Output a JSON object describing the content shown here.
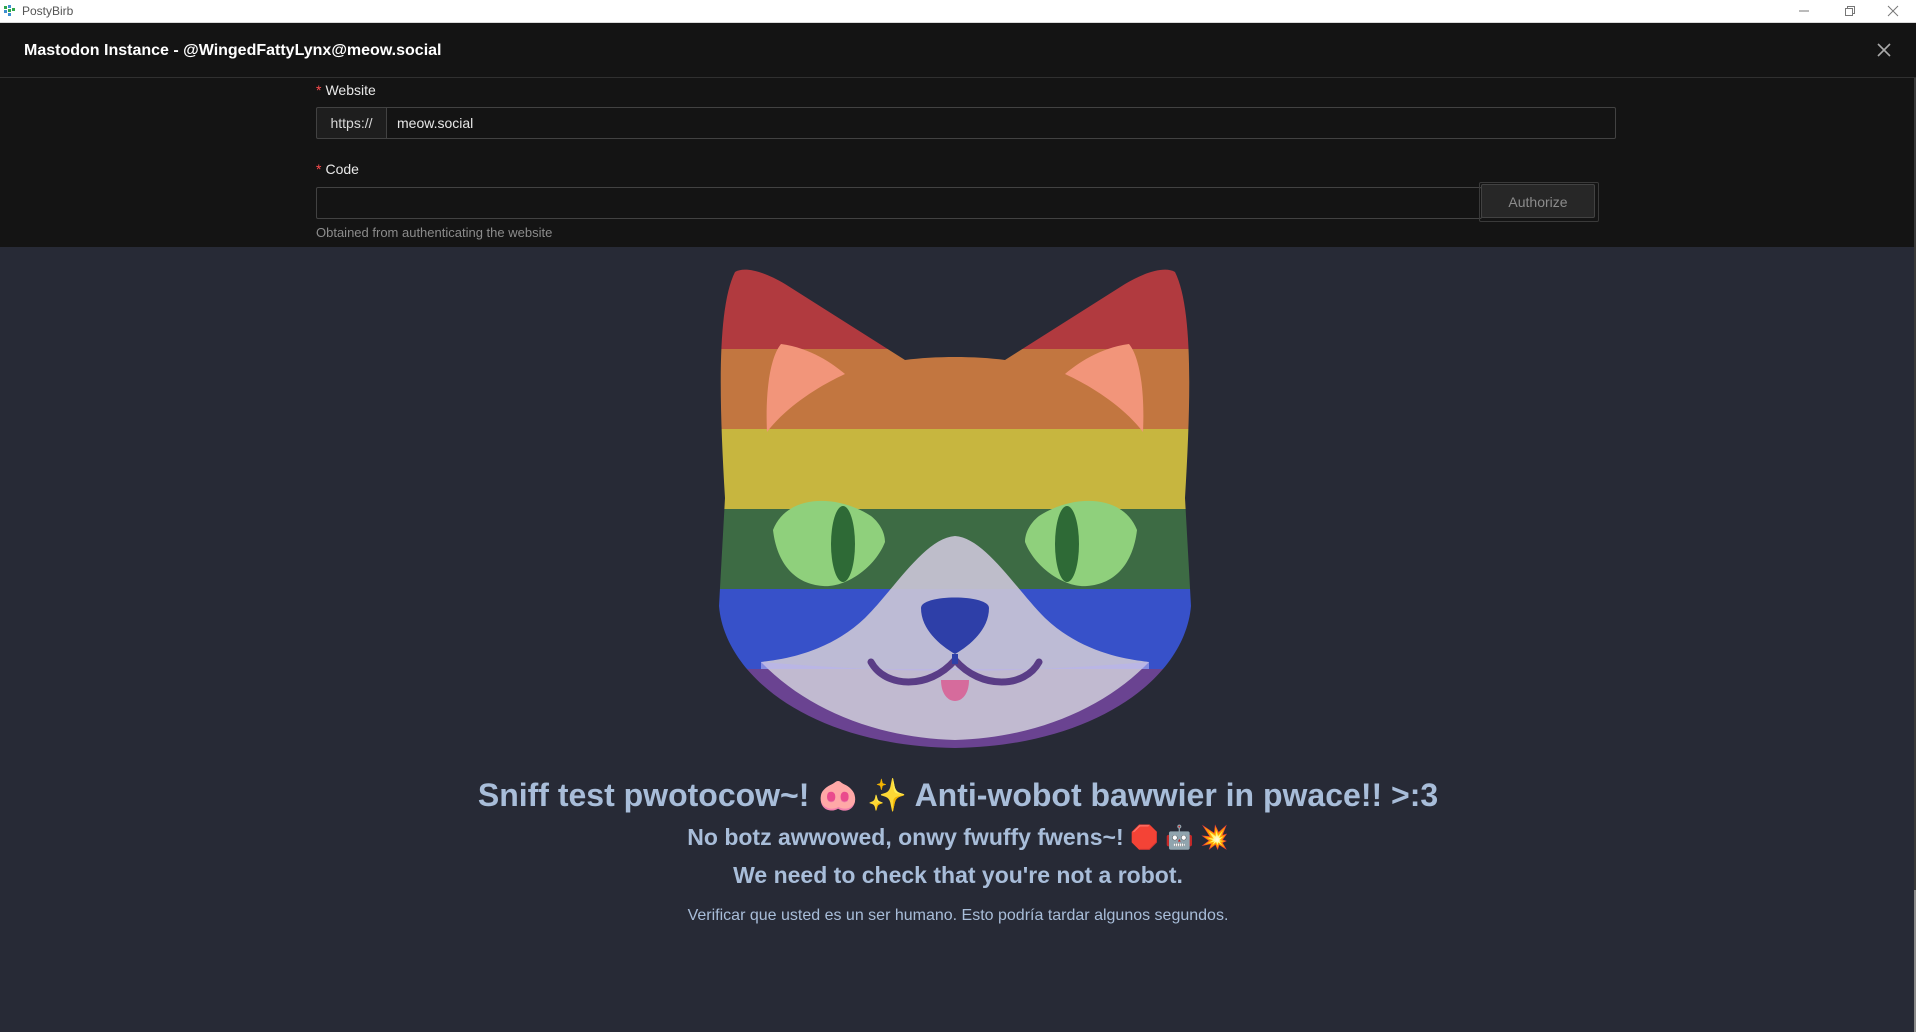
{
  "window": {
    "app_name": "PostyBirb",
    "icons": {
      "app": "postybirb-logo-icon",
      "minimize": "minimize-icon",
      "restore": "restore-icon",
      "close": "close-icon"
    }
  },
  "modal": {
    "title": "Mastodon Instance - @WingedFattyLynx@meow.social",
    "close_icon": "close-icon"
  },
  "form": {
    "website": {
      "required_mark": "*",
      "label": "Website",
      "prefix": "https://",
      "value": "meow.social"
    },
    "code": {
      "required_mark": "*",
      "label": "Code",
      "value": "",
      "button": "Authorize",
      "help": "Obtained from authenticating the website"
    }
  },
  "challenge": {
    "heading": "Sniff test pwotocow~! 🐽 ✨ Anti-wobot bawwier in pwace!! >:3",
    "subheading": "No botz awwowed, onwy fwuffy fwens~! 🛑 🤖 💥",
    "notice": "We need to check that you're not a robot.",
    "description": "Verificar que usted es un ser humano. Esto podría tardar algunos segundos.",
    "mascot_icon": "rainbow-cat-mascot-icon"
  },
  "colors": {
    "rainbow": [
      "#b13a3f",
      "#c27640",
      "#c7b63f",
      "#3d6b44",
      "#3751c9",
      "#6a4391"
    ],
    "text": "#a8bdd9",
    "background": "#272a36"
  }
}
